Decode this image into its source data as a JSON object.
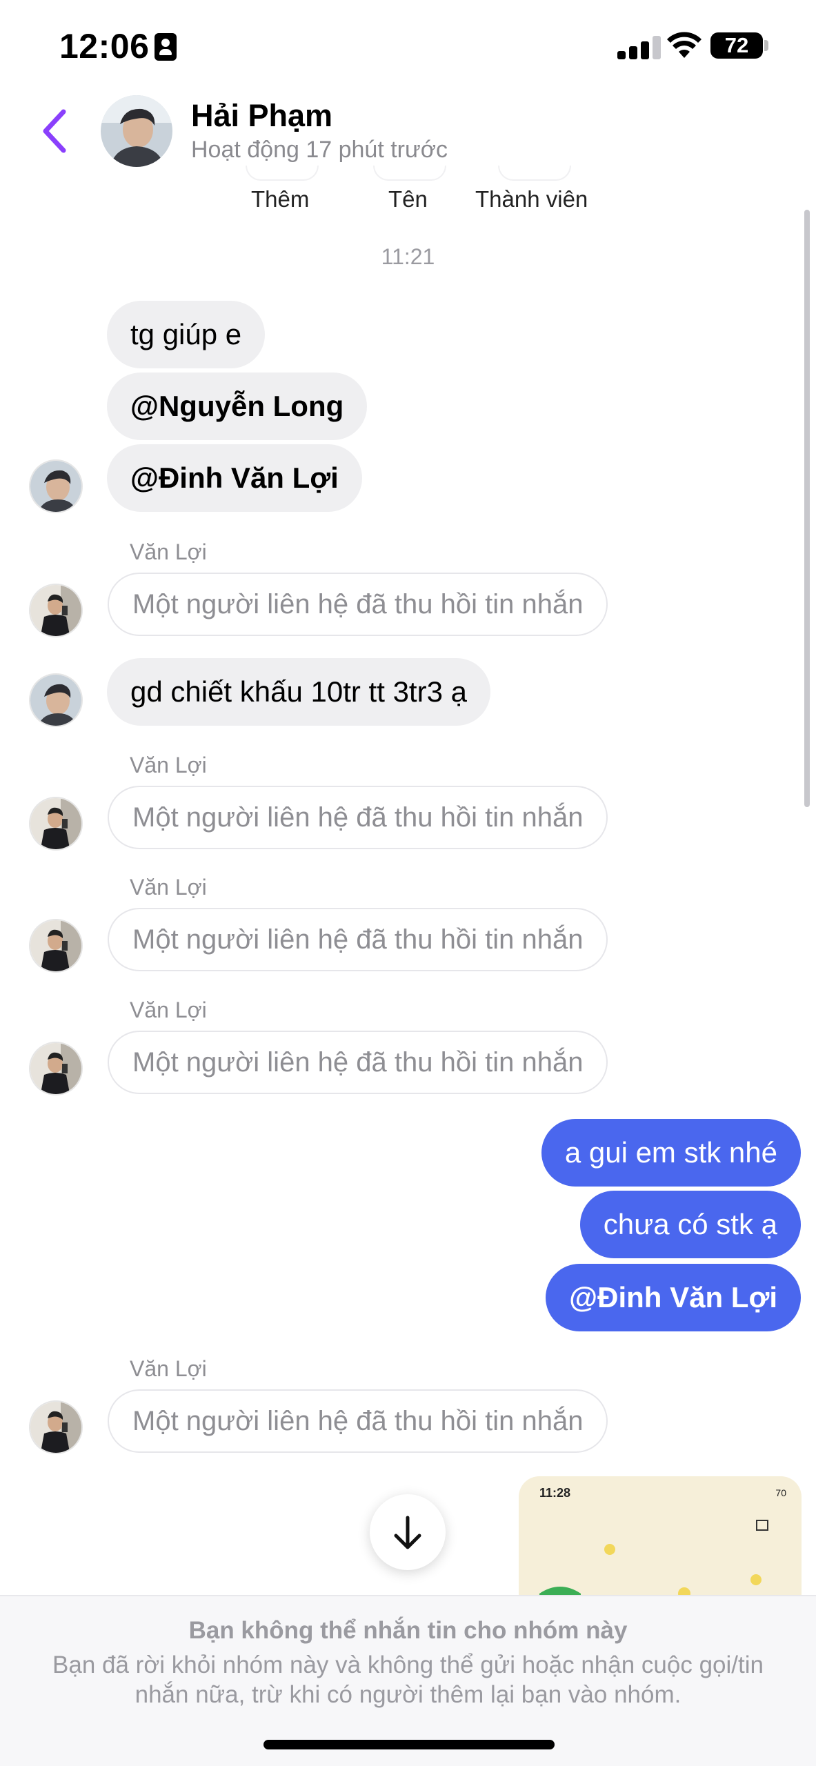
{
  "status_bar": {
    "time": "12:06",
    "battery": "72"
  },
  "header": {
    "name": "Hải Phạm",
    "status": "Hoạt động 17 phút trước"
  },
  "quick_actions": [
    "Thêm",
    "Tên",
    "Thành viên"
  ],
  "chat": {
    "timestamp": "11:21",
    "messages": [
      {
        "text": "tg giúp e"
      },
      {
        "text": "@Nguyễn Long"
      },
      {
        "text": "@Đinh Văn Lợi"
      },
      {
        "sender": "Văn Lợi",
        "text": "Một người liên hệ đã thu hồi tin nhắn"
      },
      {
        "text": "gd chiết khấu 10tr tt 3tr3 ạ"
      },
      {
        "sender": "Văn Lợi",
        "text": "Một người liên hệ đã thu hồi tin nhắn"
      },
      {
        "sender": "Văn Lợi",
        "text": "Một người liên hệ đã thu hồi tin nhắn"
      },
      {
        "sender": "Văn Lợi",
        "text": "Một người liên hệ đã thu hồi tin nhắn"
      },
      {
        "text": "a gui em stk nhé"
      },
      {
        "text": "chưa có stk ạ"
      },
      {
        "text": "@Đinh Văn Lợi"
      },
      {
        "sender": "Văn Lợi",
        "text": "Một người liên hệ đã thu hồi tin nhắn"
      }
    ],
    "image_preview": {
      "time": "11:28",
      "battery": "70"
    }
  },
  "notice": {
    "title": "Bạn không thể nhắn tin cho nhóm này",
    "body": "Bạn đã rời khỏi nhóm này và không thể gửi hoặc nhận cuộc gọi/tin nhắn nữa, trừ khi có người thêm lại bạn vào nhóm."
  },
  "colors": {
    "accent": "#8a3ffc",
    "outgoing_bubble": "#4a67ee",
    "incoming_bubble": "#efeff1"
  }
}
